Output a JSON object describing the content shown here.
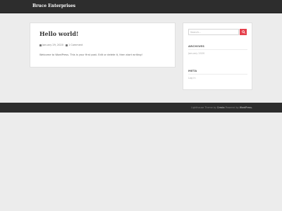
{
  "header": {
    "site_title": "Bruce Enterprises"
  },
  "post": {
    "title": "Hello world!",
    "date": "January 29, 2020",
    "comments": "1 Comment",
    "excerpt": "Welcome to WordPress. This is your first post. Edit or delete it, then start writing!"
  },
  "sidebar": {
    "search_placeholder": "Search...",
    "archives_title": "ARCHIVES",
    "archives_link": "January 2020",
    "meta_title": "META",
    "meta_link": "Log in"
  },
  "footer": {
    "theme_name": "Lighthouse",
    "theme_by": "Theme by",
    "author": "Cresta",
    "powered_by": "Powered by",
    "platform": "WordPress."
  },
  "colors": {
    "accent": "#e5414d",
    "navbar": "#2d2d2d",
    "background": "#ececec"
  }
}
